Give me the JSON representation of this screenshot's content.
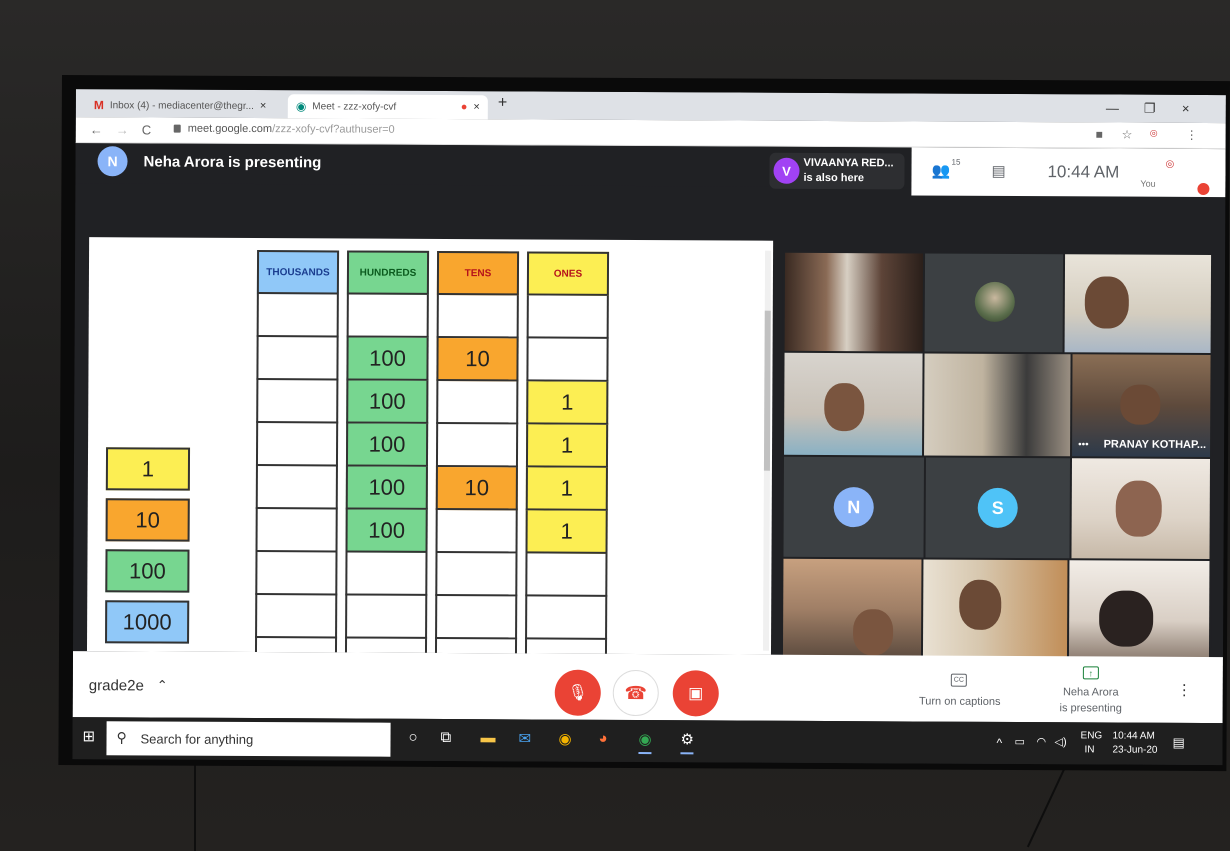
{
  "browser": {
    "tabs": [
      {
        "label": "Inbox (4) - mediacenter@thegr...",
        "icon": "gmail-icon"
      },
      {
        "label": "Meet - zzz-xofy-cvf",
        "icon": "meet-icon"
      }
    ],
    "new_tab": "+",
    "close": "×",
    "url_host": "meet.google.com",
    "url_path": "/zzz-xofy-cvf?authuser=0",
    "nav": {
      "back": "←",
      "forward": "→",
      "reload": "C"
    }
  },
  "meet": {
    "presenter_initial": "N",
    "presenting_text": "Neha Arora is presenting",
    "also_here": {
      "initial": "V",
      "name": "VIVAANYA RED...",
      "status": "is also here"
    },
    "participants_count": "15",
    "time": "10:44 AM",
    "you_label": "You",
    "tiles": {
      "pranay": "PRANAY KOTHAP...",
      "n_initial": "N",
      "s_initial": "S"
    },
    "bottom": {
      "meeting_name": "grade2e",
      "captions_label": "Turn on captions",
      "presenting_label_1": "Neha Arora",
      "presenting_label_2": "is presenting"
    },
    "colors": {
      "red": "#ea4335",
      "avatar_blue": "#8ab4f8",
      "avatar_purple": "#a142f4",
      "avatar_cyan": "#4fc3f7"
    }
  },
  "slide": {
    "columns": [
      {
        "header": "THOUSANDS",
        "color": "#90c8f8",
        "header_text_color": "#1a3d8f",
        "cells": [
          "",
          "",
          "",
          "",
          "",
          "",
          "",
          "",
          ""
        ]
      },
      {
        "header": "HUNDREDS",
        "color": "#77d690",
        "header_text_color": "#0b5b1e",
        "cells": [
          "",
          "100",
          "100",
          "100",
          "100",
          "100",
          "",
          "",
          ""
        ]
      },
      {
        "header": "TENS",
        "color": "#f9a62e",
        "header_text_color": "#b5121b",
        "cells": [
          "",
          "10",
          "",
          "",
          "10",
          "",
          "",
          "",
          ""
        ]
      },
      {
        "header": "ONES",
        "color": "#fcee53",
        "header_text_color": "#b5121b",
        "cells": [
          "",
          "",
          "1",
          "1",
          "1",
          "1",
          "",
          "",
          ""
        ]
      }
    ],
    "legend": [
      {
        "value": "1",
        "color": "#fcee53"
      },
      {
        "value": "10",
        "color": "#f9a62e"
      },
      {
        "value": "100",
        "color": "#77d690"
      },
      {
        "value": "1000",
        "color": "#90c8f8"
      }
    ]
  },
  "taskbar": {
    "search_placeholder": "Search for anything",
    "lang_1": "ENG",
    "lang_2": "IN",
    "time": "10:44 AM",
    "date": "23-Jun-20"
  }
}
